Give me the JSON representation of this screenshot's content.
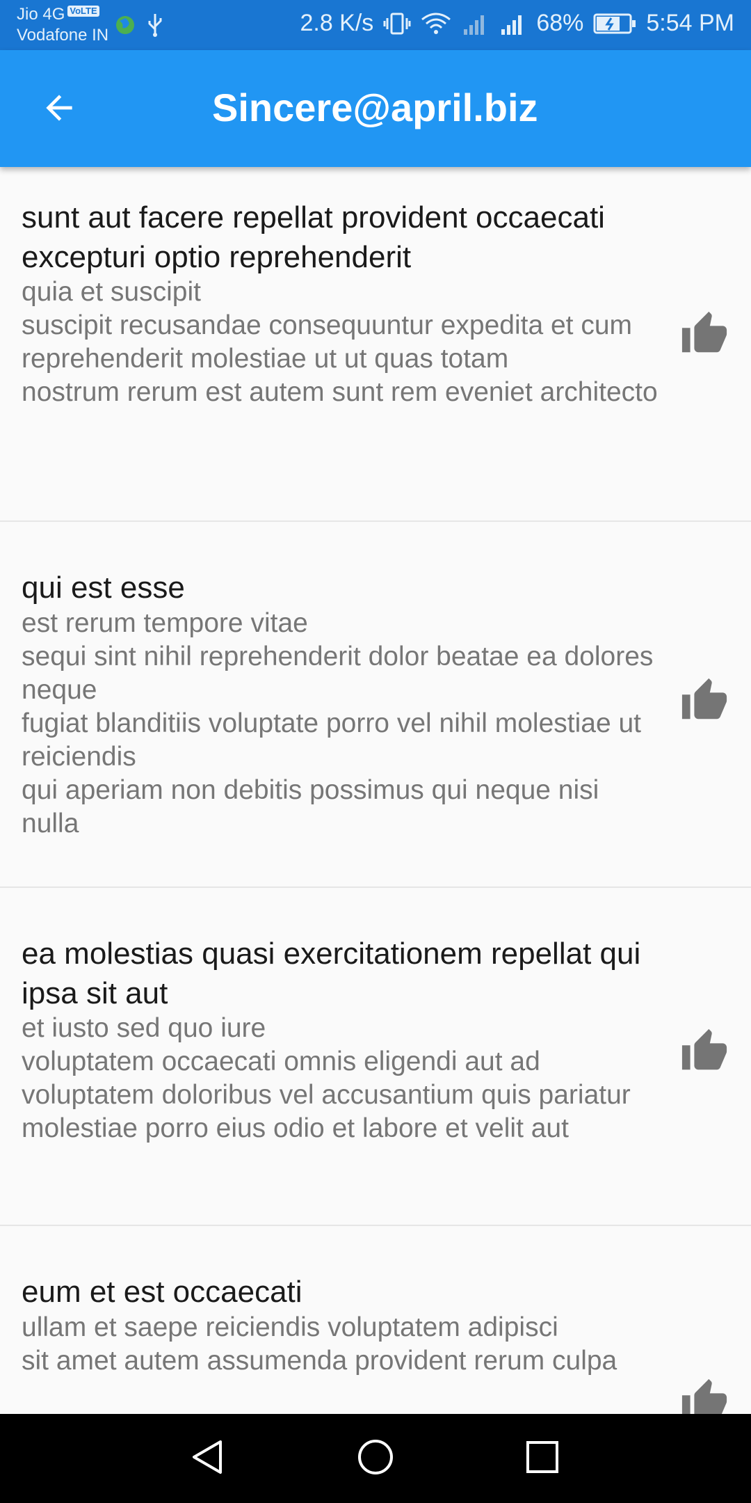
{
  "status_bar": {
    "carrier_line1": "Jio 4G",
    "volte_badge": "VoLTE",
    "carrier_line2": "Vodafone IN",
    "net_speed": "2.8 K/s",
    "battery": "68%",
    "time": "5:54 PM",
    "icons": [
      "globe-icon",
      "usb-icon",
      "vibrate-icon",
      "wifi-icon",
      "signal-icon",
      "signal-icon",
      "battery-charging-icon"
    ]
  },
  "app_bar": {
    "title": "Sincere@april.biz",
    "back_icon": "arrow-back-icon"
  },
  "posts": [
    {
      "title": "sunt aut facere repellat provident occaecati excepturi optio reprehenderit",
      "body": "quia et suscipit\nsuscipit recusandae consequuntur expedita et cum\nreprehenderit molestiae ut ut quas totam\nnostrum rerum est autem sunt rem eveniet architecto",
      "icon": "thumb-up-icon"
    },
    {
      "title": "qui est esse",
      "body": "est rerum tempore vitae\nsequi sint nihil reprehenderit dolor beatae ea dolores neque\nfugiat blanditiis voluptate porro vel nihil molestiae ut reiciendis\nqui aperiam non debitis possimus qui neque nisi nulla",
      "icon": "thumb-up-icon"
    },
    {
      "title": "ea molestias quasi exercitationem repellat qui ipsa sit aut",
      "body": "et iusto sed quo iure\nvoluptatem occaecati omnis eligendi aut ad\nvoluptatem doloribus vel accusantium quis pariatur\nmolestiae porro eius odio et labore et velit aut",
      "icon": "thumb-up-icon"
    },
    {
      "title": "eum et est occaecati",
      "body": "ullam et saepe reiciendis voluptatem adipisci\nsit amet autem assumenda provident rerum culpa",
      "icon": "thumb-up-icon"
    }
  ],
  "nav_bar": {
    "buttons": [
      "back-triangle-icon",
      "home-circle-icon",
      "recents-square-icon"
    ]
  },
  "colors": {
    "status_bar": "#1976d2",
    "app_bar": "#2196f3",
    "title_text": "#1a1a1a",
    "body_text": "#767676",
    "icon": "#757575",
    "nav_bar": "#000000"
  }
}
